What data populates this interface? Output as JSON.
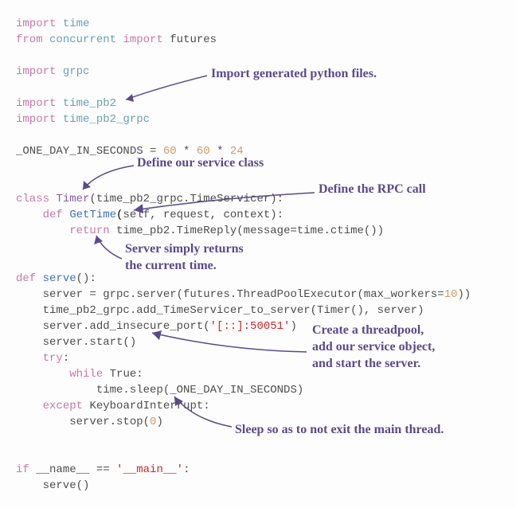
{
  "code": {
    "l1_kw": "import",
    "l1_mod": "time",
    "l2_kw1": "from",
    "l2_mod1": "concurrent",
    "l2_kw2": "import",
    "l2_mod2": "futures",
    "l3_kw": "import",
    "l3_mod": "grpc",
    "l4_kw": "import",
    "l4_mod": "time_pb2",
    "l5_kw": "import",
    "l5_mod": "time_pb2_grpc",
    "l6_var": "_ONE_DAY_IN_SECONDS = ",
    "l6_n1": "60",
    "l6_op1": " * ",
    "l6_n2": "60",
    "l6_op2": " * ",
    "l6_n3": "24",
    "l7_kw": "class",
    "l7_name": "Timer",
    "l7_rest": "(time_pb2_grpc.TimeServicer):",
    "l8_kw": "def",
    "l8_name": "GetTime",
    "l8_self": "self",
    "l8_rest": ", request, context):",
    "l9_kw": "return",
    "l9_rest": " time_pb2.TimeReply(message=time.ctime())",
    "l10_kw": "def",
    "l10_name": "serve",
    "l10_rest": "():",
    "l11": "    server = grpc.server(futures.ThreadPoolExecutor(max_workers=",
    "l11_num": "10",
    "l11_end": "))",
    "l12": "    time_pb2_grpc.add_TimeServicer_to_server(Timer(), server)",
    "l13": "    server.add_insecure_port(",
    "l13_str": "'[::]:50051'",
    "l13_end": ")",
    "l14": "    server.start()",
    "l15_kw": "try",
    "l15_rest": ":",
    "l16_kw": "while",
    "l16_true": "True",
    "l16_rest": ":",
    "l17": "            time.sleep(_ONE_DAY_IN_SECONDS)",
    "l18_kw": "except",
    "l18_exc": "KeyboardInterrupt",
    "l18_rest": ":",
    "l19": "        server.stop(",
    "l19_num": "0",
    "l19_end": ")",
    "l20_kw": "if",
    "l20_name": "__name__",
    "l20_eq": " == ",
    "l20_str": "'__main__'",
    "l20_rest": ":",
    "l21": "    serve()"
  },
  "annotations": {
    "a1": "Import generated python files.",
    "a2": "Define our service class",
    "a3": "Define the RPC call",
    "a4_l1": "Server simply returns",
    "a4_l2": "the current time.",
    "a5_l1": "Create a threadpool,",
    "a5_l2": "add our service object,",
    "a5_l3": "and start the server.",
    "a6": "Sleep so as to not exit the main thread."
  }
}
